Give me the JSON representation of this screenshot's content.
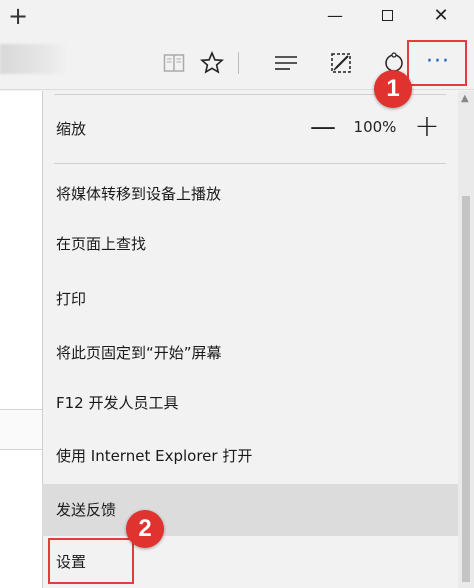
{
  "window": {
    "new_tab_glyph": "+",
    "minimize_glyph": "—",
    "close_glyph": "✕"
  },
  "toolbar": {
    "icons": [
      "reading-view-icon",
      "favorite-star-icon",
      "hub-icon",
      "web-note-icon",
      "share-icon",
      "more-icon"
    ],
    "more_glyph": "···"
  },
  "menu": {
    "zoom": {
      "label": "缩放",
      "minus": "—",
      "value": "100%",
      "plus": "+"
    },
    "items": [
      "将媒体转移到设备上播放",
      "在页面上查找",
      "打印",
      "将此页固定到“开始”屏幕",
      "F12 开发人员工具",
      "使用 Internet Explorer 打开",
      "发送反馈",
      "设置"
    ]
  },
  "annotations": {
    "badge_1": "1",
    "badge_2": "2",
    "highlight_color": "#e23c3c"
  },
  "colors": {
    "background": "#f2f2f2",
    "more_icon": "#1f5fb8",
    "hover_row": "#dcdcdc",
    "badge": "#e0322f"
  }
}
